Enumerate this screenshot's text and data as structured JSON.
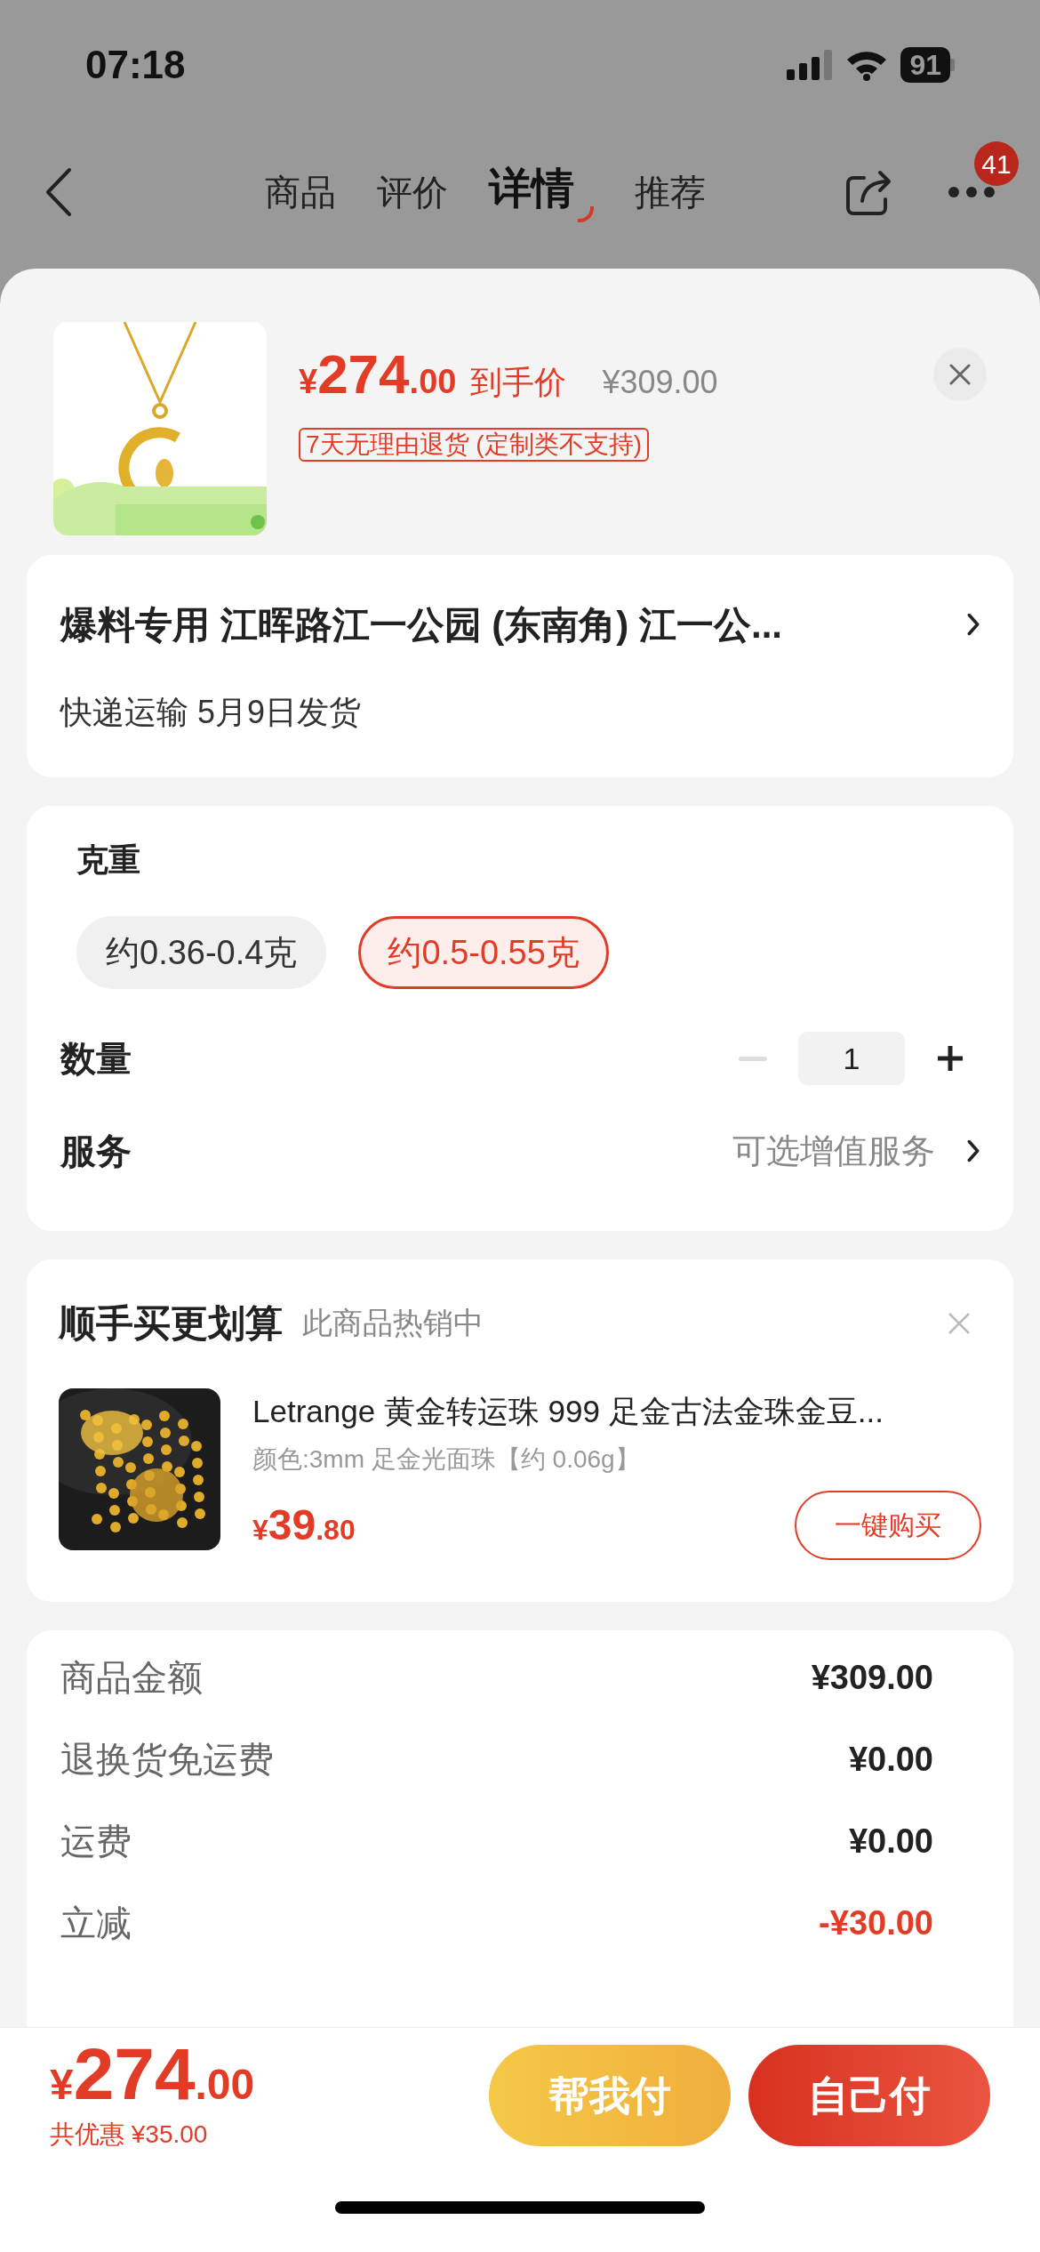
{
  "status_bar": {
    "time": "07:18",
    "battery": "91"
  },
  "nav": {
    "tabs": [
      {
        "label": "商品",
        "selected": false
      },
      {
        "label": "评价",
        "selected": false
      },
      {
        "label": "详情",
        "selected": true
      },
      {
        "label": "推荐",
        "selected": false
      }
    ],
    "badge": "41"
  },
  "product": {
    "currency": "¥",
    "price_integer": "274",
    "price_decimal": ".00",
    "price_label": "到手价",
    "original_price": "¥309.00",
    "return_policy": "7天无理由退货 (定制类不支持)"
  },
  "address": {
    "line": "爆料专用  江晖路江一公园 (东南角) 江一公...",
    "shipping": "快递运输 5月9日发货"
  },
  "options": {
    "title": "克重",
    "choices": [
      {
        "label": "约0.36-0.4克",
        "selected": false
      },
      {
        "label": "约0.5-0.55克",
        "selected": true
      }
    ],
    "quantity_label": "数量",
    "quantity": "1",
    "minus_disabled": true,
    "service_label": "服务",
    "service_value": "可选增值服务"
  },
  "upsell": {
    "title": "顺手买更划算",
    "subtitle": "此商品热销中",
    "item": {
      "name": "Letrange 黄金转运珠 999 足金古法金珠金豆...",
      "variant": "颜色:3mm 足金光面珠【约 0.06g】",
      "currency": "¥",
      "price_integer": "39",
      "price_decimal": ".80",
      "button": "一键购买"
    }
  },
  "summary": [
    {
      "label": "商品金额",
      "value": "¥309.00",
      "kind": "normal"
    },
    {
      "label": "退换货免运费",
      "value": "¥0.00",
      "kind": "normal"
    },
    {
      "label": "运费",
      "value": "¥0.00",
      "kind": "normal"
    },
    {
      "label": "立减",
      "value": "-¥30.00",
      "kind": "discount"
    }
  ],
  "footer": {
    "currency": "¥",
    "price_integer": "274",
    "price_decimal": ".00",
    "savings": "共优惠 ¥35.00",
    "buttons": [
      {
        "label": "帮我付",
        "kind": "secondary"
      },
      {
        "label": "自己付",
        "kind": "primary"
      }
    ]
  }
}
